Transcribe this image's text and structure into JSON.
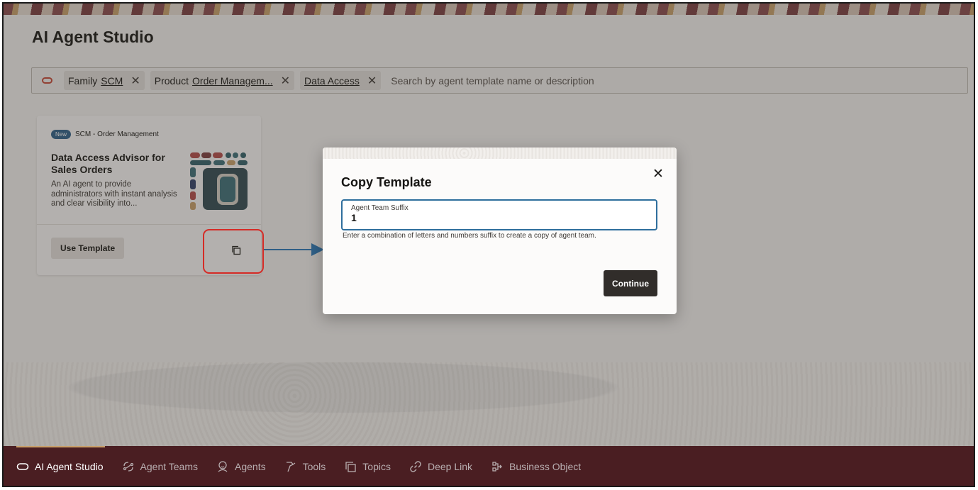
{
  "page": {
    "title": "AI Agent Studio"
  },
  "filters": {
    "chips": [
      {
        "label": "Family",
        "value": "SCM"
      },
      {
        "label": "Product",
        "value": "Order Managem..."
      },
      {
        "label": "",
        "value": "Data Access"
      }
    ],
    "search_placeholder": "Search by agent template name or description"
  },
  "card": {
    "badge": "New",
    "category": "SCM - Order Management",
    "title": "Data Access Advisor for Sales Orders",
    "description": "An AI agent to provide administrators with instant analysis and clear visibility into...",
    "use_button": "Use Template"
  },
  "dialog": {
    "title": "Copy Template",
    "field_label": "Agent Team Suffix",
    "field_value": "1",
    "help_text": "Enter a combination of letters and numbers suffix to create a copy of agent team.",
    "continue_label": "Continue"
  },
  "nav": {
    "items": [
      {
        "label": "AI Agent Studio",
        "icon": "pill-icon",
        "active": true
      },
      {
        "label": "Agent Teams",
        "icon": "agent-teams-icon"
      },
      {
        "label": "Agents",
        "icon": "agents-icon"
      },
      {
        "label": "Tools",
        "icon": "tools-icon"
      },
      {
        "label": "Topics",
        "icon": "topics-icon"
      },
      {
        "label": "Deep Link",
        "icon": "link-icon"
      },
      {
        "label": "Business Object",
        "icon": "business-object-icon"
      }
    ]
  },
  "colors": {
    "accent_red": "#c74634",
    "nav_bg": "#4a1e22",
    "primary_button": "#312d2a",
    "focus_blue": "#2f6f9d",
    "annotation_red": "#d52b26",
    "annotation_arrow": "#2f5f86"
  }
}
